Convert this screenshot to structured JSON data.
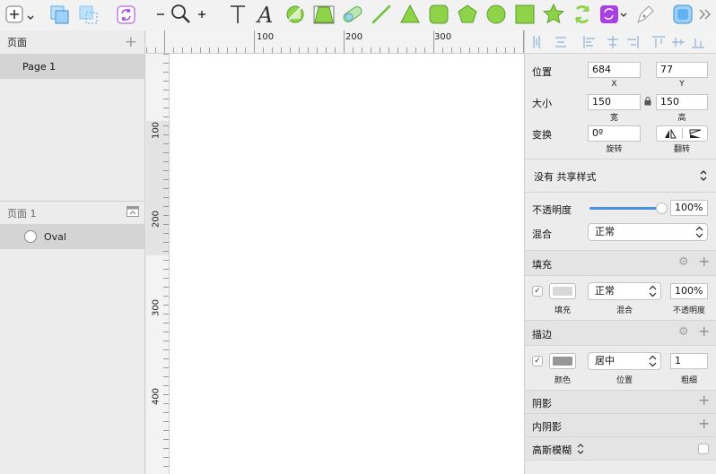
{
  "sidebar": {
    "pages_title": "页面",
    "page_item": "Page 1",
    "layers_title": "页面 1",
    "layer_item": "Oval"
  },
  "rulers": {
    "h_labels": [
      "100",
      "200",
      "300"
    ],
    "v_labels": [
      "100",
      "200",
      "300",
      "400"
    ]
  },
  "inspector": {
    "position": {
      "label": "位置",
      "x": "684",
      "y": "77",
      "x_caption": "X",
      "y_caption": "Y"
    },
    "size": {
      "label": "大小",
      "width": "150",
      "height": "150",
      "width_caption": "宽",
      "height_caption": "高"
    },
    "transform": {
      "label": "变换",
      "rotation": "0º",
      "rotation_caption": "旋转",
      "flip_caption": "翻转"
    },
    "shared_style": "没有 共享样式",
    "opacity": {
      "label": "不透明度",
      "value": "100%",
      "level": 1.0
    },
    "blend": {
      "label": "混合",
      "value": "正常"
    },
    "fill": {
      "title": "填充",
      "blend": "正常",
      "opacity": "100%",
      "caption_fill": "填充",
      "caption_blend": "混合",
      "caption_opacity": "不透明度",
      "color": "#d8d8d8"
    },
    "border": {
      "title": "描边",
      "position": "居中",
      "thickness": "1",
      "caption_color": "颜色",
      "caption_position": "位置",
      "caption_thickness": "粗细",
      "color": "#979797"
    },
    "shadow_title": "阴影",
    "inner_shadow_title": "内阴影",
    "blur_title": "高斯模糊"
  },
  "colors": {
    "accent": "#4a90e2",
    "shape_green": "#8ed34a",
    "plugin_purple": "#a93fe0"
  },
  "toolbar": {
    "icons": [
      "insert-icon",
      "group-icon",
      "ungroup-icon",
      "create-symbol-icon",
      "zoom-out-icon",
      "zoom-icon",
      "zoom-in-icon",
      "text-icon",
      "typeface-icon",
      "mask-icon",
      "scale-icon",
      "union-icon",
      "line-icon",
      "triangle-icon",
      "rounded-rect-icon",
      "pentagon-icon",
      "oval-icon",
      "rectangle-icon",
      "star-icon",
      "rotate-icon",
      "plugin-icon",
      "vector-pen-icon",
      "preview-icon",
      "more-icon"
    ]
  }
}
